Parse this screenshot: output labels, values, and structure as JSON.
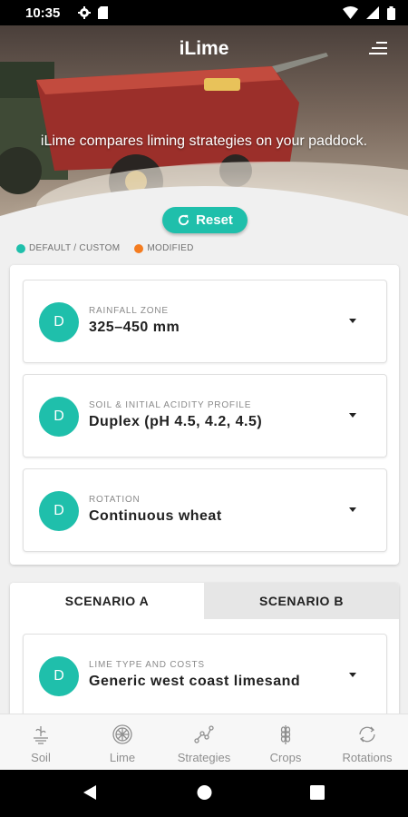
{
  "status_bar": {
    "time": "10:35"
  },
  "header": {
    "title": "iLime",
    "tagline": "iLime compares liming strategies on your paddock."
  },
  "reset_label": "Reset",
  "legend": [
    {
      "label": "DEFAULT / CUSTOM",
      "color": "#1fbfab"
    },
    {
      "label": "MODIFIED",
      "color": "#f47c20"
    }
  ],
  "settings": [
    {
      "badge": "D",
      "label": "RAINFALL ZONE",
      "value": "325–450 mm"
    },
    {
      "badge": "D",
      "label": "SOIL & INITIAL ACIDITY PROFILE",
      "value": "Duplex (pH 4.5, 4.2, 4.5)"
    },
    {
      "badge": "D",
      "label": "ROTATION",
      "value": "Continuous wheat"
    }
  ],
  "scenario_tabs": [
    {
      "label": "SCENARIO A",
      "active": true
    },
    {
      "label": "SCENARIO B",
      "active": false
    }
  ],
  "scenario_settings": [
    {
      "badge": "D",
      "label": "LIME TYPE AND COSTS",
      "value": "Generic west coast limesand"
    }
  ],
  "bottom_nav": [
    {
      "label": "Soil",
      "icon": "soil-icon"
    },
    {
      "label": "Lime",
      "icon": "lime-icon"
    },
    {
      "label": "Strategies",
      "icon": "strategies-icon"
    },
    {
      "label": "Crops",
      "icon": "crops-icon"
    },
    {
      "label": "Rotations",
      "icon": "rotations-icon"
    }
  ],
  "colors": {
    "accent": "#1fbfab",
    "modified": "#f47c20",
    "spreader_red": "#a8322c"
  }
}
